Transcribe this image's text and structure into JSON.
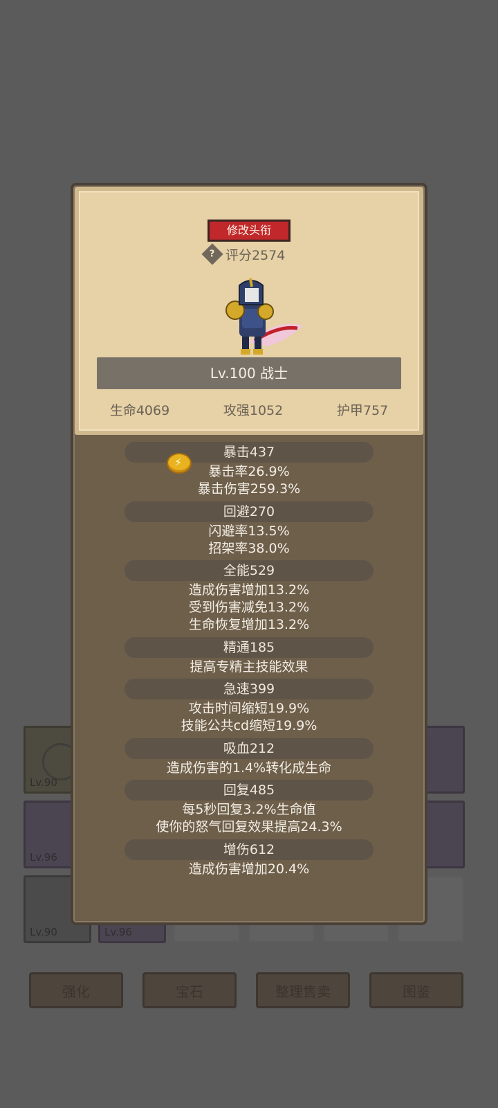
{
  "panel": {
    "title_button": "修改头衔",
    "score": "评分2574",
    "level_class": "Lv.100 战士",
    "basic_stats": [
      "生命4069",
      "攻强1052",
      "护甲757"
    ]
  },
  "stats": [
    {
      "header": "暴击437",
      "lines": [
        "暴击率26.9%",
        "暴击伤害259.3%"
      ]
    },
    {
      "header": "回避270",
      "lines": [
        "闪避率13.5%",
        "招架率38.0%"
      ]
    },
    {
      "header": "全能529",
      "lines": [
        "造成伤害增加13.2%",
        "受到伤害减免13.2%",
        "生命恢复增加13.2%"
      ]
    },
    {
      "header": "精通185",
      "lines": [
        "提高专精主技能效果"
      ]
    },
    {
      "header": "急速399",
      "lines": [
        "攻击时间缩短19.9%",
        "技能公共cd缩短19.9%"
      ]
    },
    {
      "header": "吸血212",
      "lines": [
        "造成伤害的1.4%转化成生命"
      ]
    },
    {
      "header": "回复485",
      "lines": [
        "每5秒回复3.2%生命值",
        "使你的怒气回复效果提高24.3%"
      ]
    },
    {
      "header": "增伤612",
      "lines": [
        "造成伤害增加20.4%"
      ]
    }
  ],
  "background": {
    "slots": [
      {
        "level": "Lv.90"
      },
      {
        "level": "96"
      },
      {
        "level": "Lv.96"
      },
      {
        "level": "95"
      },
      {
        "level": "Lv.90"
      },
      {
        "level": "Lv.96"
      }
    ],
    "buttons": [
      "强化",
      "宝石",
      "整理售卖",
      "图鉴"
    ]
  },
  "colors": {
    "title_button": "#c1282b",
    "parchment": "#e7d1a6",
    "panel": "#6e5f4b"
  },
  "icons": [
    "help-icon",
    "coin-icon",
    "warrior-avatar"
  ]
}
